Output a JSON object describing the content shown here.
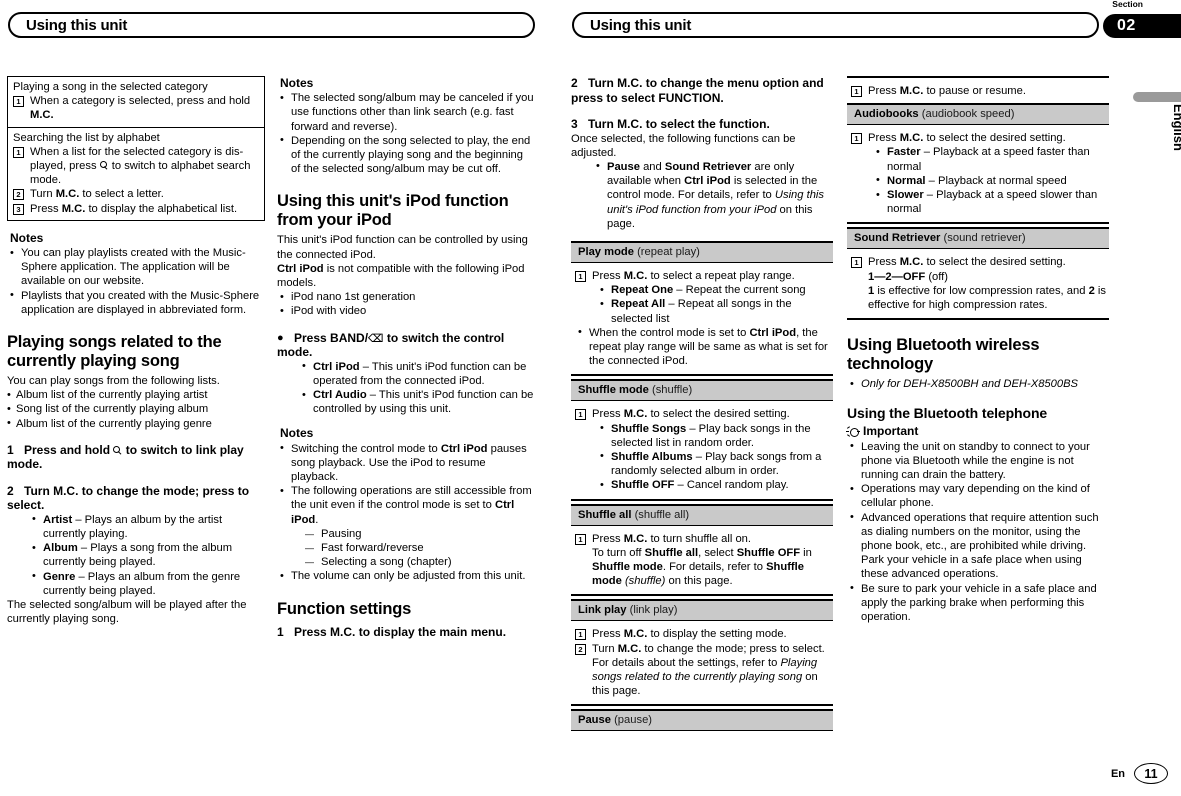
{
  "header": {
    "left_title": "Using this unit",
    "right_title": "Using this unit",
    "section_word": "Section",
    "section_number": "02",
    "language_tab": "English"
  },
  "footer": {
    "lang_code": "En",
    "page_number": "11"
  },
  "col1": {
    "table": {
      "cell1": {
        "caption": "Playing a song in the selected category",
        "step1_marker": "1",
        "step1_a": "When a category is selected, press and hold",
        "step1_b": "M.C."
      },
      "cell2": {
        "caption": "Searching the list by alphabet",
        "step1_marker": "1",
        "step1_a": "When a list for the selected category is dis-played, press",
        "step1_b": "to switch to alphabet search mode.",
        "step2_marker": "2",
        "step2_a": "Turn ",
        "step2_b": "M.C.",
        "step2_c": " to select a letter.",
        "step3_marker": "3",
        "step3_a": "Press ",
        "step3_b": "M.C.",
        "step3_c": " to display the alphabetical list."
      }
    },
    "notes_title": "Notes",
    "note1": "You can play playlists created with the Music-Sphere application. The application will be available on our website.",
    "note2": "Playlists that you created with the Music-Sphere application are displayed in abbreviated form.",
    "heading": "Playing songs related to the currently playing song",
    "intro": "You can play songs from the following lists.",
    "list": [
      "Album list of the currently playing artist",
      "Song list of the currently playing album",
      "Album list of the currently playing genre"
    ],
    "step1_num": "1",
    "step1_a": "Press and hold",
    "step1_b": "to switch to link play mode.",
    "step2_num": "2",
    "step2_text": "Turn M.C. to change the mode; press to select.",
    "modes": [
      {
        "name": "Artist",
        "desc": " – Plays an album by the artist currently playing."
      },
      {
        "name": "Album",
        "desc": " – Plays a song from the album currently being played."
      },
      {
        "name": "Genre",
        "desc": " – Plays an album from the genre currently being played."
      }
    ],
    "closing": "The selected song/album will be played after the currently playing song."
  },
  "col2": {
    "notes_title": "Notes",
    "note1": "The selected song/album may be canceled if you use functions other than link search (e.g. fast forward and reverse).",
    "note2": "Depending on the song selected to play, the end of the currently playing song and the beginning of the selected song/album may be cut off.",
    "heading": "Using this unit's iPod function from your iPod",
    "p1": "This unit's iPod function can be controlled by using the connected iPod.",
    "p2_bold": "Ctrl iPod",
    "p2_rest": " is not compatible with the following iPod models.",
    "models": [
      "iPod nano 1st generation",
      "iPod with video"
    ],
    "band_step_a": "Press BAND/",
    "band_step_b": " to switch the control mode.",
    "ctrl_modes": [
      {
        "name": "Ctrl iPod",
        "desc": " – This unit's iPod function can be operated from the connected iPod."
      },
      {
        "name": "Ctrl Audio",
        "desc": " – This unit's iPod function can be controlled by using this unit."
      }
    ],
    "notes2_title": "Notes",
    "note3_a": "Switching the control mode to ",
    "note3_b": "Ctrl iPod",
    "note3_c": " pauses song playback. Use the iPod to resume playback.",
    "note4_a": "The following operations are still accessible from the unit even if the control mode is set to ",
    "note4_b": "Ctrl iPod",
    "note4_c": ".",
    "note4_sub": [
      "Pausing",
      "Fast forward/reverse",
      "Selecting a song (chapter)"
    ],
    "note5": "The volume can only be adjusted from this unit.",
    "fn_heading": "Function settings",
    "fn_step1_num": "1",
    "fn_step1_text": "Press M.C. to display the main menu."
  },
  "col3": {
    "step2_num": "2",
    "step2_text": "Turn M.C. to change the menu option and press to select FUNCTION.",
    "step3_num": "3",
    "step3_text": "Turn M.C. to select the function.",
    "step3_sub": "Once selected, the following functions can be adjusted.",
    "bullet_a": "Pause",
    "bullet_b": " and ",
    "bullet_c": "Sound Retriever",
    "bullet_d": " are only available when ",
    "bullet_e": "Ctrl iPod",
    "bullet_f": " is selected in the control mode. For details, refer to ",
    "bullet_g": "Using this unit's iPod function from your iPod",
    "bullet_h": " on this page.",
    "play_mode": {
      "label": "Play mode",
      "paren": "(repeat play)",
      "step_marker": "1",
      "step_a": "Press ",
      "step_b": "M.C.",
      "step_c": " to select a repeat play range.",
      "options": [
        {
          "name": "Repeat One",
          "desc": " – Repeat the current song"
        },
        {
          "name": "Repeat All",
          "desc": " – Repeat all songs in the selected list"
        }
      ],
      "note_a": "When the control mode is set to ",
      "note_b": "Ctrl iPod",
      "note_c": ", the repeat play range will be same as what is set for the connected iPod."
    },
    "shuffle_mode": {
      "label": "Shuffle mode",
      "paren": "(shuffle)",
      "step_marker": "1",
      "step_a": "Press ",
      "step_b": "M.C.",
      "step_c": " to select the desired setting.",
      "options": [
        {
          "name": "Shuffle Songs",
          "desc": " – Play back songs in the selected list in random order."
        },
        {
          "name": "Shuffle Albums",
          "desc": " – Play back songs from a randomly selected album in order."
        },
        {
          "name": "Shuffle OFF",
          "desc": " – Cancel random play."
        }
      ]
    },
    "shuffle_all": {
      "label": "Shuffle all",
      "paren": "(shuffle all)",
      "step_marker": "1",
      "step_a": "Press ",
      "step_b": "M.C.",
      "step_c": " to turn shuffle all on.",
      "line2_a": "To turn off ",
      "line2_b": "Shuffle all",
      "line2_c": ", select ",
      "line2_d": "Shuffle OFF",
      "line2_e": " in ",
      "line2_f": "Shuffle mode",
      "line2_g": ". For details, refer to ",
      "line2_h": "Shuffle mode",
      "line2_i": " (shuffle)",
      "line2_j": " on this page."
    },
    "link_play": {
      "label": "Link play",
      "paren": "(link play)",
      "step1_marker": "1",
      "step1_a": "Press ",
      "step1_b": "M.C.",
      "step1_c": " to display the setting mode.",
      "step2_marker": "2",
      "step2_a": "Turn ",
      "step2_b": "M.C.",
      "step2_c": " to change the mode; press to select. For details about the settings, refer to ",
      "step2_d": "Playing songs related to the currently playing song",
      "step2_e": " on this page."
    },
    "pause": {
      "label": "Pause",
      "paren": "(pause)"
    }
  },
  "col4": {
    "pause_step": {
      "marker": "1",
      "a": "Press ",
      "b": "M.C.",
      "c": " to pause or resume."
    },
    "audiobooks": {
      "label": "Audiobooks",
      "paren": "(audiobook speed)",
      "step_marker": "1",
      "step_a": "Press ",
      "step_b": "M.C.",
      "step_c": " to select the desired setting.",
      "options": [
        {
          "name": "Faster",
          "desc": " – Playback at a speed faster than normal"
        },
        {
          "name": "Normal",
          "desc": " – Playback at normal speed"
        },
        {
          "name": "Slower",
          "desc": " – Playback at a speed slower than normal"
        }
      ]
    },
    "sound_retriever": {
      "label": "Sound Retriever",
      "paren": "(sound retriever)",
      "step_marker": "1",
      "step_a": "Press ",
      "step_b": "M.C.",
      "step_c": " to select the desired setting.",
      "values_1": "1",
      "values_dash1": "—",
      "values_2": "2",
      "values_dash2": "—",
      "values_off": "OFF",
      "values_offparen": " (off)",
      "expl_a": "1",
      "expl_b": " is effective for low compression rates, and ",
      "expl_c": "2",
      "expl_d": " is effective for high compression rates."
    },
    "bt_heading": "Using Bluetooth wireless technology",
    "bt_note": "Only for DEH-X8500BH and DEH-X8500BS",
    "bt_sub_heading": "Using the Bluetooth telephone",
    "important_label": "Important",
    "important_items": [
      "Leaving the unit on standby to connect to your phone via Bluetooth while the engine is not running can drain the battery.",
      "Operations may vary depending on the kind of cellular phone.",
      "Advanced operations that require attention such as dialing numbers on the monitor, using the phone book, etc., are prohibited while driving. Park your vehicle in a safe place when using these advanced operations.",
      "Be sure to park your vehicle in a safe place and apply the parking brake when performing this operation."
    ]
  }
}
